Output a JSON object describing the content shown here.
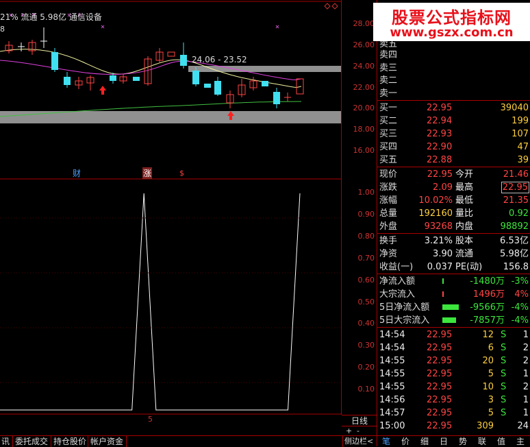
{
  "header": {
    "info": "21% 流通 5.98亿  通信设备",
    "left_num": "8"
  },
  "main_chart": {
    "y_ticks": [
      "28.00",
      "26.00",
      "24.00",
      "22.00",
      "20.00",
      "18.00",
      "16.00"
    ],
    "range_label": "24.06 - 23.52",
    "markers": {
      "cai": "财",
      "zhang": "涨",
      "dollar": "$"
    }
  },
  "sub_chart": {
    "y_ticks": [
      "1.00",
      "0.90",
      "0.80",
      "0.70",
      "0.60",
      "0.50",
      "0.40",
      "0.30",
      "0.20",
      "0.10"
    ],
    "x_label": "5",
    "mode_label": "日线",
    "plus": "+",
    "minus": "-",
    "sidebar_toggle": "侧边栏<"
  },
  "chart_data": {
    "type": "line",
    "ylim": [
      0,
      1
    ],
    "x": [
      1,
      2,
      3,
      4,
      5,
      6,
      7,
      8,
      9,
      10,
      11,
      12,
      13,
      14,
      15,
      16,
      17,
      18,
      19,
      20,
      21,
      22,
      23,
      24,
      25,
      26
    ],
    "values": [
      0,
      0,
      0,
      0,
      0,
      0,
      0,
      0,
      0,
      0,
      0,
      0,
      1,
      0,
      0,
      0,
      0,
      0,
      0,
      0,
      0,
      0,
      0,
      0,
      0,
      1
    ]
  },
  "logo": {
    "title": "股票公式指标网",
    "url": "www.gszx.com.cn"
  },
  "quote": {
    "sell": [
      {
        "label": "卖五"
      },
      {
        "label": "卖四"
      },
      {
        "label": "卖三"
      },
      {
        "label": "卖二"
      },
      {
        "label": "卖一"
      }
    ],
    "buy": [
      {
        "label": "买一",
        "price": "22.95",
        "vol": "39040"
      },
      {
        "label": "买二",
        "price": "22.94",
        "vol": "199"
      },
      {
        "label": "买三",
        "price": "22.93",
        "vol": "107"
      },
      {
        "label": "买四",
        "price": "22.90",
        "vol": "47"
      },
      {
        "label": "买五",
        "price": "22.88",
        "vol": "39"
      }
    ],
    "stats": [
      {
        "l1": "现价",
        "v1": "22.95",
        "l2": "今开",
        "v2": "21.46"
      },
      {
        "l1": "涨跌",
        "v1": "2.09",
        "l2": "最高",
        "v2": "22.95"
      },
      {
        "l1": "涨幅",
        "v1": "10.02%",
        "l2": "最低",
        "v2": "21.35"
      },
      {
        "l1": "总量",
        "v1": "192160",
        "l2": "量比",
        "v2": "0.92"
      },
      {
        "l1": "外盘",
        "v1": "93268",
        "l2": "内盘",
        "v2": "98892"
      }
    ],
    "stats2": [
      {
        "l1": "换手",
        "v1": "3.21%",
        "l2": "股本",
        "v2": "6.53亿"
      },
      {
        "l1": "净资",
        "v1": "3.90",
        "l2": "流通",
        "v2": "5.98亿"
      },
      {
        "l1": "收益(一)",
        "v1": "0.037",
        "l2": "PE(动)",
        "v2": "156.8"
      }
    ],
    "flows": [
      {
        "label": "净流入额",
        "value": "-1480万",
        "pct": "-3%"
      },
      {
        "label": "大宗流入",
        "value": "1496万",
        "pct": "4%"
      },
      {
        "label": "5日净流入额",
        "value": "-9566万",
        "pct": "-4%"
      },
      {
        "label": "5日大宗流入",
        "value": "-7857万",
        "pct": "-4%"
      }
    ],
    "ticks": [
      {
        "time": "14:54",
        "price": "22.95",
        "vol": "12",
        "side": "S",
        "n": "1"
      },
      {
        "time": "14:54",
        "price": "22.95",
        "vol": "6",
        "side": "S",
        "n": "2"
      },
      {
        "time": "14:55",
        "price": "22.95",
        "vol": "20",
        "side": "S",
        "n": "2"
      },
      {
        "time": "14:55",
        "price": "22.95",
        "vol": "5",
        "side": "S",
        "n": "1"
      },
      {
        "time": "14:55",
        "price": "22.95",
        "vol": "10",
        "side": "S",
        "n": "2"
      },
      {
        "time": "14:56",
        "price": "22.95",
        "vol": "3",
        "side": "S",
        "n": "1"
      },
      {
        "time": "14:57",
        "price": "22.95",
        "vol": "5",
        "side": "S",
        "n": "1"
      },
      {
        "time": "15:00",
        "price": "22.95",
        "vol": "309",
        "side": "",
        "n": "24"
      }
    ]
  },
  "bottom_tabs": [
    "讯",
    "委托成交",
    "持仓股价",
    "帐户资金"
  ],
  "right_tabs": [
    "笔",
    "价",
    "细",
    "日",
    "势",
    "联",
    "值",
    "主"
  ]
}
